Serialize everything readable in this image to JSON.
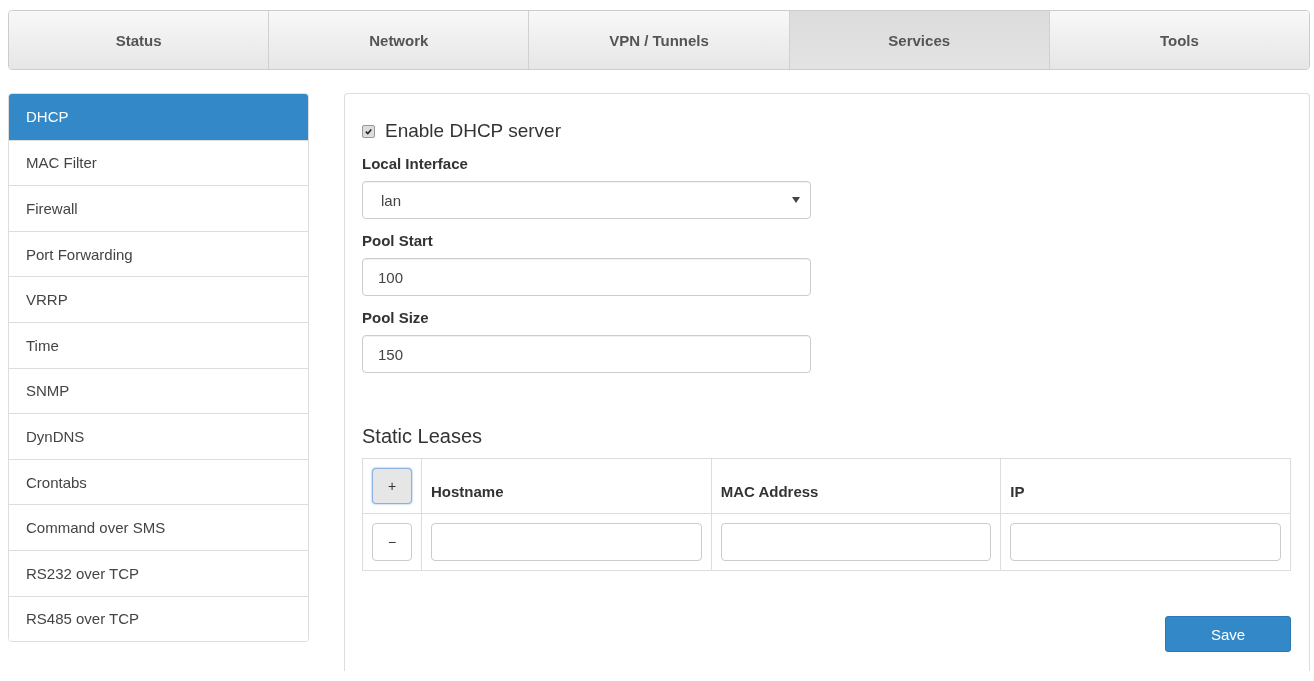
{
  "tabs": [
    {
      "label": "Status",
      "selected": false
    },
    {
      "label": "Network",
      "selected": false
    },
    {
      "label": "VPN / Tunnels",
      "selected": false
    },
    {
      "label": "Services",
      "selected": true
    },
    {
      "label": "Tools",
      "selected": false
    }
  ],
  "sidebar": {
    "items": [
      {
        "label": "DHCP",
        "selected": true
      },
      {
        "label": "MAC Filter",
        "selected": false
      },
      {
        "label": "Firewall",
        "selected": false
      },
      {
        "label": "Port Forwarding",
        "selected": false
      },
      {
        "label": "VRRP",
        "selected": false
      },
      {
        "label": "Time",
        "selected": false
      },
      {
        "label": "SNMP",
        "selected": false
      },
      {
        "label": "DynDNS",
        "selected": false
      },
      {
        "label": "Crontabs",
        "selected": false
      },
      {
        "label": "Command over SMS",
        "selected": false
      },
      {
        "label": "RS232 over TCP",
        "selected": false
      },
      {
        "label": "RS485 over TCP",
        "selected": false
      }
    ]
  },
  "form": {
    "enable": {
      "label": "Enable DHCP server",
      "checked": true
    },
    "local_interface": {
      "label": "Local Interface",
      "value": "lan"
    },
    "pool_start": {
      "label": "Pool Start",
      "value": "100"
    },
    "pool_size": {
      "label": "Pool Size",
      "value": "150"
    }
  },
  "static_leases": {
    "title": "Static Leases",
    "add_button": "+",
    "columns": [
      "Hostname",
      "MAC Address",
      "IP"
    ],
    "rows": [
      {
        "remove_button": "−"
      }
    ]
  },
  "save_button": "Save"
}
